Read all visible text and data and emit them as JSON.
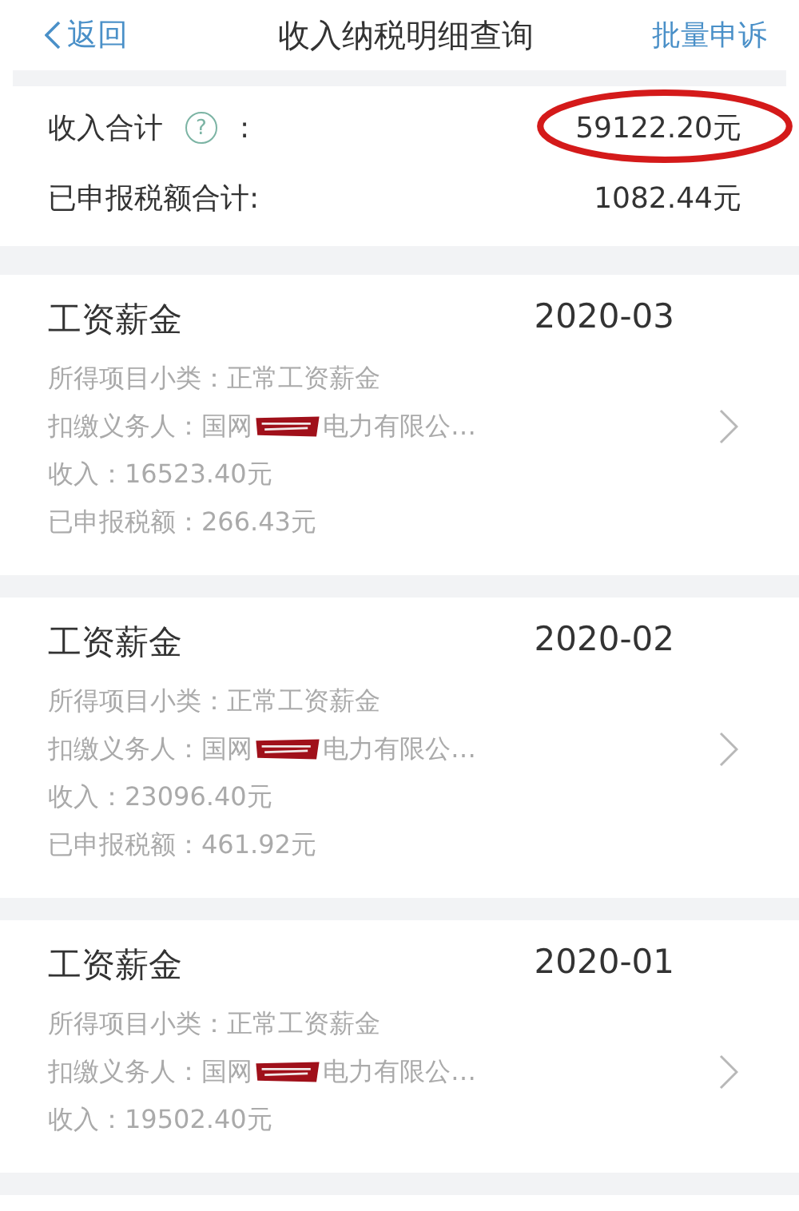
{
  "nav": {
    "back": "返回",
    "title": "收入纳税明细查询",
    "action": "批量申诉"
  },
  "summary": {
    "income_label": "收入合计",
    "help": "?",
    "colon": ":",
    "income_value": "59122.20元",
    "income_circled": true,
    "tax_label": "已申报税额合计:",
    "tax_value": "1082.44元"
  },
  "records": [
    {
      "type": "工资薪金",
      "period": "2020-03",
      "subtype": "所得项目小类：正常工资薪金",
      "payer_label": "扣缴义务人：",
      "payer_prefix": "国网",
      "payer_redacted": true,
      "payer_suffix": "电力有限公…",
      "income": "收入：16523.40元",
      "tax": "已申报税额：266.43元"
    },
    {
      "type": "工资薪金",
      "period": "2020-02",
      "subtype": "所得项目小类：正常工资薪金",
      "payer_label": "扣缴义务人：",
      "payer_prefix": "国网",
      "payer_redacted": true,
      "payer_suffix": "电力有限公…",
      "income": "收入：23096.40元",
      "tax": "已申报税额：461.92元"
    },
    {
      "type": "工资薪金",
      "period": "2020-01",
      "subtype": "所得项目小类：正常工资薪金",
      "payer_label": "扣缴义务人：",
      "payer_prefix": "国网",
      "payer_redacted": true,
      "payer_suffix": "电力有限公…",
      "income": "收入：19502.40元"
    }
  ]
}
